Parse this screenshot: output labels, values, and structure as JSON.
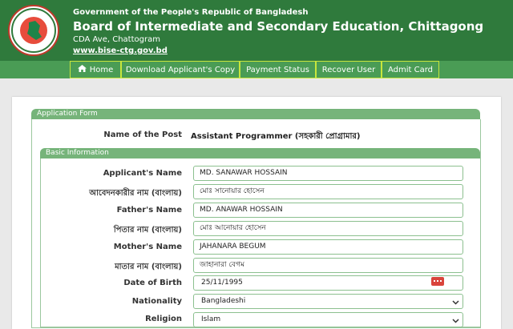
{
  "header": {
    "gov_title": "Government of the People's Republic of Bangladesh",
    "board_title": "Board of Intermediate and Secondary Education, Chittagong",
    "address": "CDA Ave, Chattogram",
    "url": "www.bise-ctg.gov.bd"
  },
  "nav": {
    "home": "Home",
    "download": "Download Applicant's Copy",
    "payment": "Payment Status",
    "recover": "Recover User",
    "admit": "Admit Card"
  },
  "form": {
    "section_title": "Application Form",
    "post_label": "Name of the Post",
    "post_value": "Assistant Programmer (সহকারী প্রোগ্রামার)",
    "basic_title": "Basic Information",
    "fields": {
      "applicant_name": {
        "label": "Applicant's Name",
        "value": "MD. SANAWAR HOSSAIN"
      },
      "applicant_name_bn": {
        "label": "আবেদনকারীর নাম (বাংলায়)",
        "value": "মোঃ সানোয়ার হোসেন"
      },
      "father_name": {
        "label": "Father's Name",
        "value": "MD. ANAWAR HOSSAIN"
      },
      "father_name_bn": {
        "label": "পিতার নাম (বাংলায়)",
        "value": "মোঃ আনোয়ার হোসেন"
      },
      "mother_name": {
        "label": "Mother's Name",
        "value": "JAHANARA BEGUM"
      },
      "mother_name_bn": {
        "label": "মাতার নাম (বাংলায়)",
        "value": "জাহানারা বেগম"
      },
      "dob": {
        "label": "Date of Birth",
        "value": "25/11/1995"
      },
      "nationality": {
        "label": "Nationality",
        "value": "Bangladeshi"
      },
      "religion": {
        "label": "Religion",
        "value": "Islam"
      }
    }
  },
  "colors": {
    "header_green": "#2f7a3c",
    "nav_green": "#4a9c55",
    "legend_green": "#76b47a",
    "nav_border": "#c8e63c",
    "logo_red": "#c0392b"
  }
}
